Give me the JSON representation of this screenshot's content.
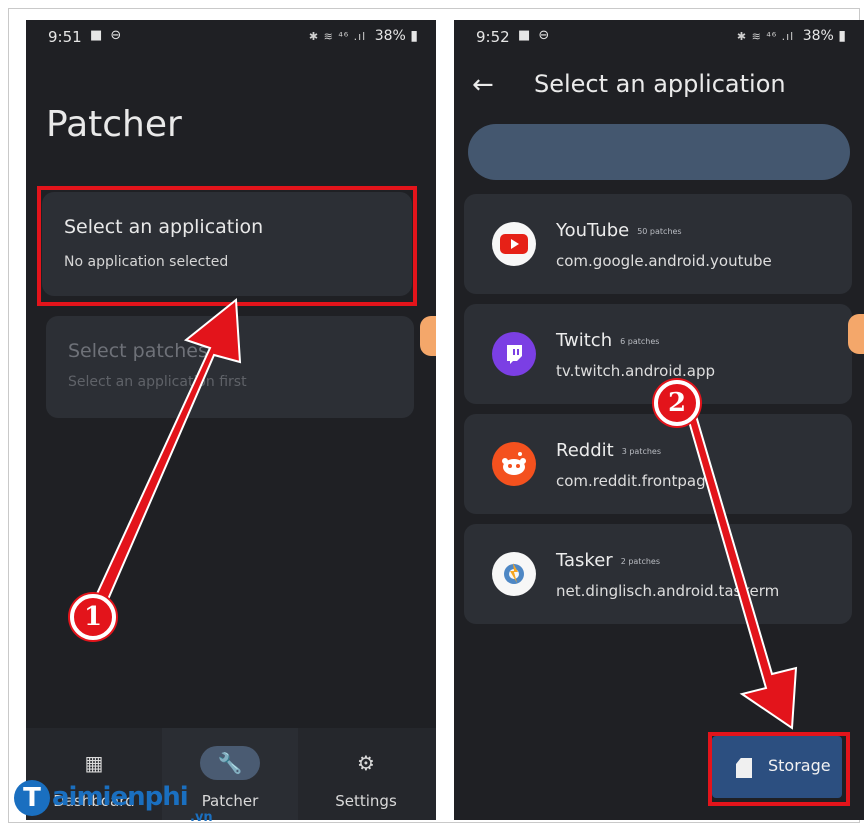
{
  "left_screen": {
    "status": {
      "time": "9:51",
      "battery": "38%"
    },
    "title": "Patcher",
    "cards": [
      {
        "heading": "Select an application",
        "sub": "No application selected",
        "enabled": true
      },
      {
        "heading": "Select patches",
        "sub": "Select an application first",
        "enabled": false
      }
    ],
    "nav": [
      {
        "label": "Dashboard",
        "icon": "dashboard-icon",
        "active": false
      },
      {
        "label": "Patcher",
        "icon": "wrench-icon",
        "active": true
      },
      {
        "label": "Settings",
        "icon": "gear-icon",
        "active": false
      }
    ]
  },
  "right_screen": {
    "status": {
      "time": "9:52",
      "battery": "38%"
    },
    "title": "Select an application",
    "apps": [
      {
        "name": "YouTube",
        "patches": "50 patches",
        "package": "com.google.android.youtube",
        "icon": "youtube-icon",
        "color": "#e62117"
      },
      {
        "name": "Twitch",
        "patches": "6 patches",
        "package": "tv.twitch.android.app",
        "icon": "twitch-icon",
        "color": "#7b3fe4"
      },
      {
        "name": "Reddit",
        "patches": "3 patches",
        "package": "com.reddit.frontpage",
        "icon": "reddit-icon",
        "color": "#f4511e"
      },
      {
        "name": "Tasker",
        "patches": "2 patches",
        "package": "net.dinglisch.android.taskerm",
        "icon": "tasker-icon",
        "color": "#4e87c4"
      }
    ],
    "storage_button": "Storage"
  },
  "annotations": {
    "step1": "1",
    "step2": "2",
    "accent": "#e3141b"
  },
  "watermark": {
    "logo_letter": "T",
    "brand": "aimienphi",
    "tld": ".vn"
  }
}
